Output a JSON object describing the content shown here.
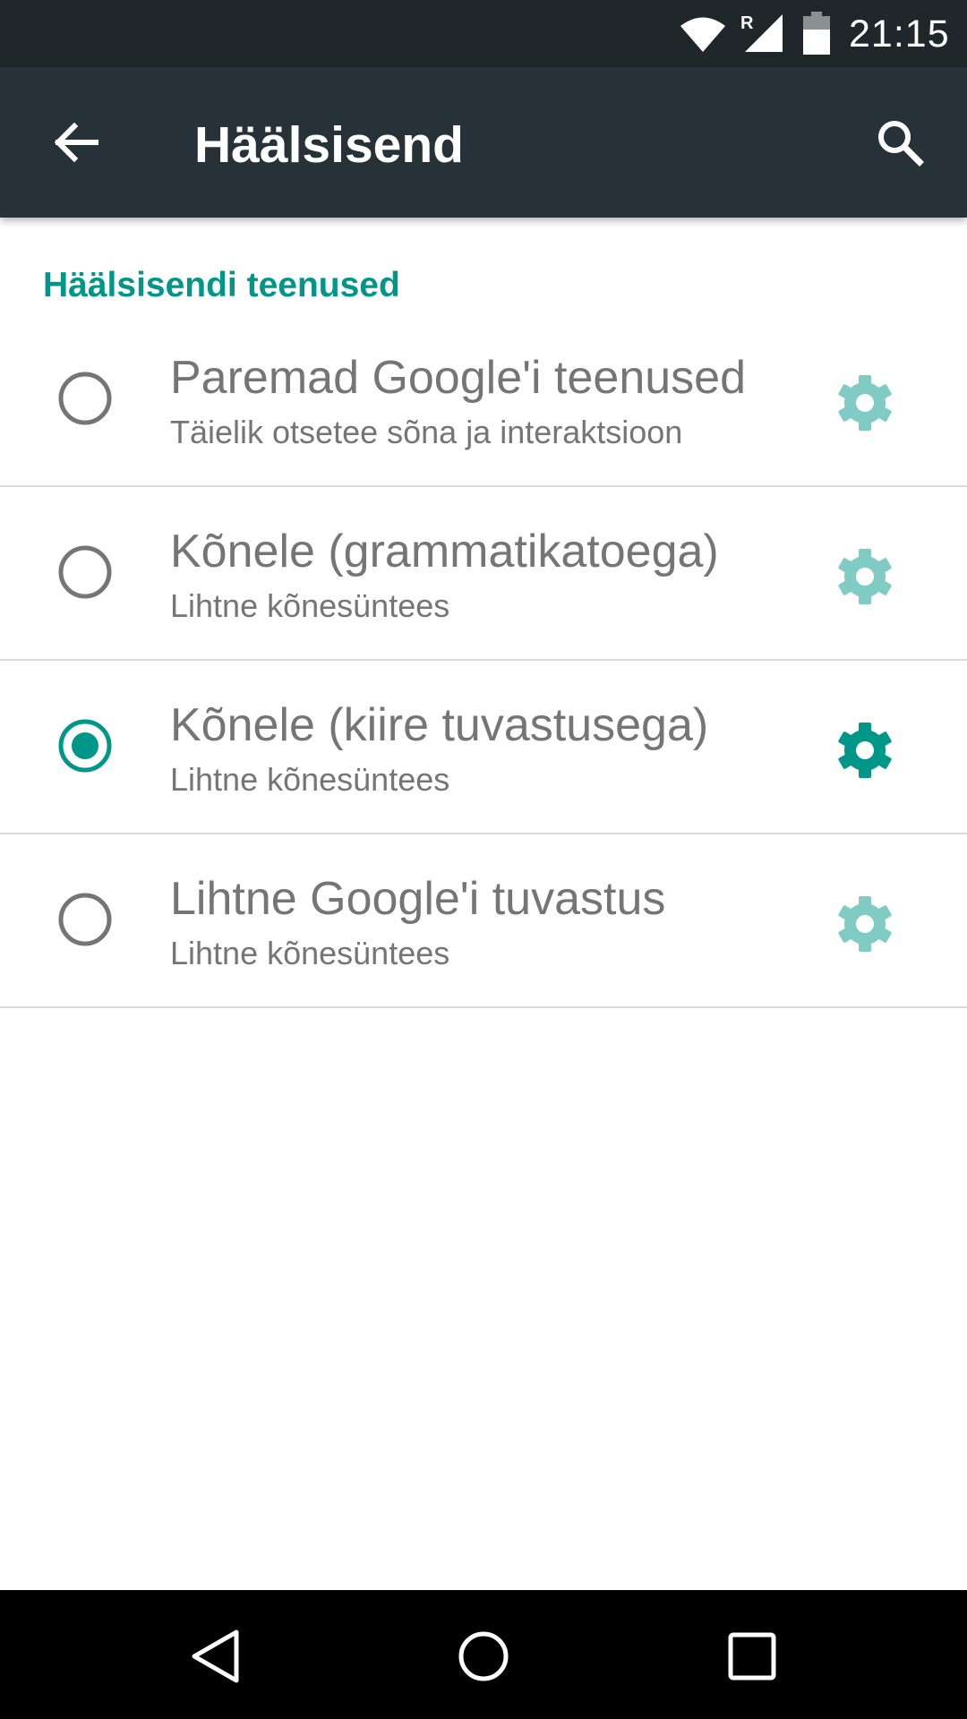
{
  "status_bar": {
    "time": "21:15",
    "roaming_indicator": "R",
    "icons": [
      "wifi-icon",
      "cell-signal-icon",
      "battery-icon"
    ]
  },
  "app_bar": {
    "title": "Häälsisend",
    "icons": [
      "arrow-back-icon",
      "search-icon"
    ]
  },
  "section": {
    "header": "Häälsisendi teenused"
  },
  "services": [
    {
      "title": "Paremad Google'i teenused",
      "summary": "Täielik otsetee sõna ja interaktsioon",
      "selected": false
    },
    {
      "title": "Kõnele (grammatikatoega)",
      "summary": "Lihtne kõnesüntees",
      "selected": false
    },
    {
      "title": "Kõnele (kiire tuvastusega)",
      "summary": "Lihtne kõnesüntees",
      "selected": true
    },
    {
      "title": "Lihtne Google'i tuvastus",
      "summary": "Lihtne kõnesüntees",
      "selected": false
    }
  ],
  "nav_bar": {
    "icons": [
      "back-triangle-icon",
      "home-circle-icon",
      "recents-square-icon"
    ]
  },
  "colors": {
    "status_bar": "#1f272b",
    "app_bar": "#263238",
    "accent": "#009688",
    "accent_disabled": "#80cbc4",
    "text_secondary": "#757575",
    "divider": "#dadada"
  }
}
